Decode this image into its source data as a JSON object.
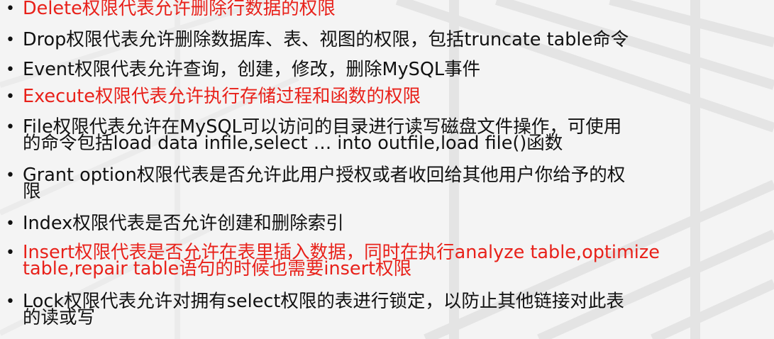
{
  "slide": {
    "bullets": [
      {
        "text": "Delete权限代表允许删除行数据的权限",
        "color": "#e8211a"
      },
      {
        "text": "Drop权限代表允许删除数据库、表、视图的权限，包括truncate table命令",
        "color": "#111111"
      },
      {
        "text": "Event权限代表允许查询，创建，修改，删除MySQL事件",
        "color": "#111111"
      },
      {
        "text": "Execute权限代表允许执行存储过程和函数的权限",
        "color": "#e8211a"
      },
      {
        "text": "File权限代表允许在MySQL可以访问的目录进行读写磁盘文件操作，可使用\n的命令包括load data infile,select … into outfile,load file()函数",
        "color": "#111111"
      },
      {
        "text": "Grant option权限代表是否允许此用户授权或者收回给其他用户你给予的权\n限",
        "color": "#111111"
      },
      {
        "text": "Index权限代表是否允许创建和删除索引",
        "color": "#111111"
      },
      {
        "text": "Insert权限代表是否允许在表里插入数据，同时在执行analyze table,optimize\ntable,repair table语句的时候也需要insert权限",
        "color": "#e8211a"
      },
      {
        "text": "Lock权限代表允许对拥有select权限的表进行锁定，以防止其他链接对此表\n的读或写",
        "color": "#111111"
      }
    ],
    "bullet_symbol": "•"
  }
}
